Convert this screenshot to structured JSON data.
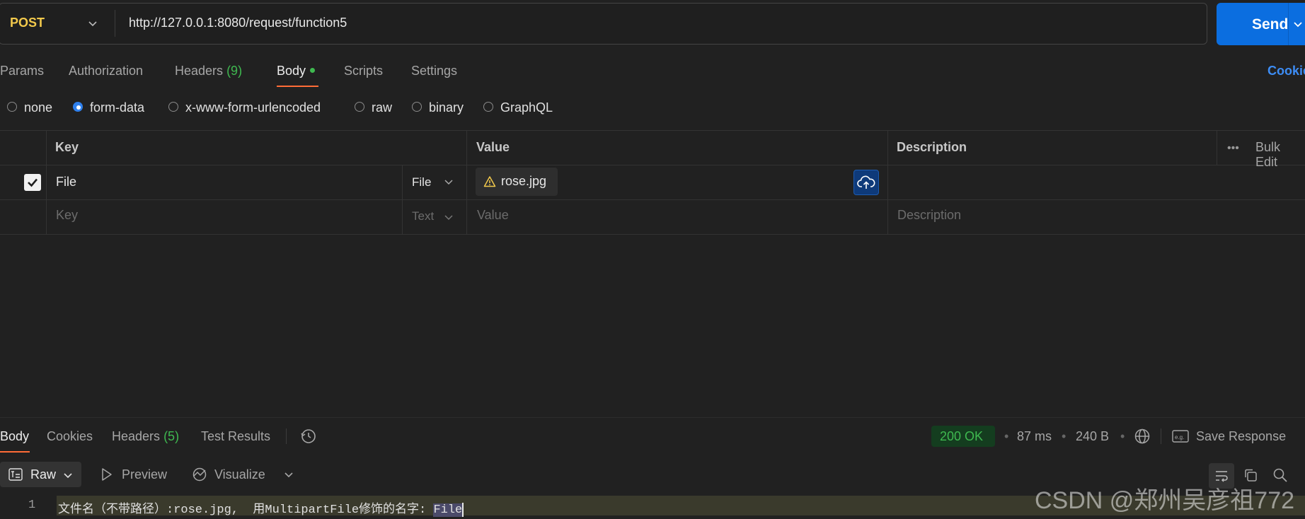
{
  "request": {
    "method": "POST",
    "url": "http://127.0.0.1:8080/request/function5",
    "send_label": "Send"
  },
  "request_tabs": {
    "params": "Params",
    "authorization": "Authorization",
    "headers_label": "Headers",
    "headers_count": "(9)",
    "body": "Body",
    "scripts": "Scripts",
    "settings": "Settings",
    "cookies": "Cookies"
  },
  "body_types": {
    "none": "none",
    "form_data": "form-data",
    "urlencoded": "x-www-form-urlencoded",
    "raw": "raw",
    "binary": "binary",
    "graphql": "GraphQL",
    "selected": "form-data"
  },
  "form_table": {
    "headers": {
      "key": "Key",
      "value": "Value",
      "description": "Description",
      "bulk_edit": "Bulk Edit"
    },
    "rows": [
      {
        "checked": true,
        "key": "File",
        "type": "File",
        "value": "rose.jpg",
        "description": ""
      }
    ],
    "new_row": {
      "key_placeholder": "Key",
      "type": "Text",
      "value_placeholder": "Value",
      "description_placeholder": "Description"
    }
  },
  "response": {
    "tabs": {
      "body": "Body",
      "cookies": "Cookies",
      "headers_label": "Headers",
      "headers_count": "(5)",
      "test_results": "Test Results"
    },
    "status": "200 OK",
    "time": "87 ms",
    "size": "240 B",
    "save_response": "Save Response",
    "view": {
      "raw": "Raw",
      "preview": "Preview",
      "visualize": "Visualize"
    },
    "lines": [
      {
        "num": "1",
        "text": "文件名（不带路径）:rose.jpg,  用MultipartFile修饰的名字: ",
        "highlight": "File"
      }
    ]
  },
  "watermark": "CSDN @郑州吴彦祖772",
  "colors": {
    "accent": "#ff6c37",
    "send": "#0b6ee0",
    "success": "#3fb950",
    "method": "#f2c94c"
  }
}
